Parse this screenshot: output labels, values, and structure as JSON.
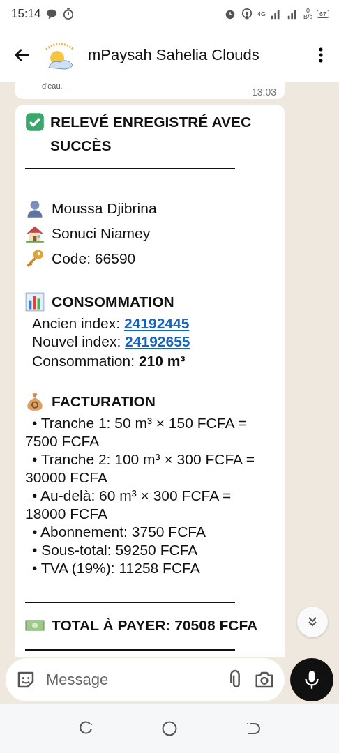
{
  "status_bar": {
    "time": "15:14",
    "network": "4G",
    "speed_value": "0",
    "speed_unit": "B/s",
    "battery": "67"
  },
  "header": {
    "title": "mPaysah Sahelia Clouds"
  },
  "previous_message": {
    "text": "d'eau.",
    "time": "13:03"
  },
  "message": {
    "title": "RELEVÉ ENREGISTRÉ AVEC SUCCÈS",
    "rule_1": "———————————————",
    "details": [
      {
        "kind": "name",
        "text": "Moussa Djibrina"
      },
      {
        "kind": "address",
        "text": "Sonuci Niamey"
      },
      {
        "kind": "code",
        "text": "Code: 66590"
      }
    ],
    "consumption": {
      "heading": "CONSOMMATION",
      "old_index": {
        "label": "Ancien index:",
        "value": "24192445"
      },
      "new_index": {
        "label": "Nouvel index:",
        "value": "24192655"
      },
      "total": "Consommation: **210 m³**"
    },
    "billing": {
      "heading": "FACTURATION",
      "items": [
        "• Tranche 1: 50 m³ × 150 FCFA = 7500 FCFA",
        "• Tranche 2: 100 m³ × 300 FCFA = 30000 FCFA",
        "• Au-delà: 60 m³ × 300 FCFA = 18000 FCFA",
        "• Abonnement: 3750 FCFA",
        "• Sous-total: 59250 FCFA",
        "• TVA (19%): 11258 FCFA"
      ]
    },
    "rule_2": "———————————————",
    "total": "TOTAL À PAYER: 70508 FCFA",
    "rule_3": "———————————————"
  },
  "composer": {
    "placeholder": "Message"
  }
}
